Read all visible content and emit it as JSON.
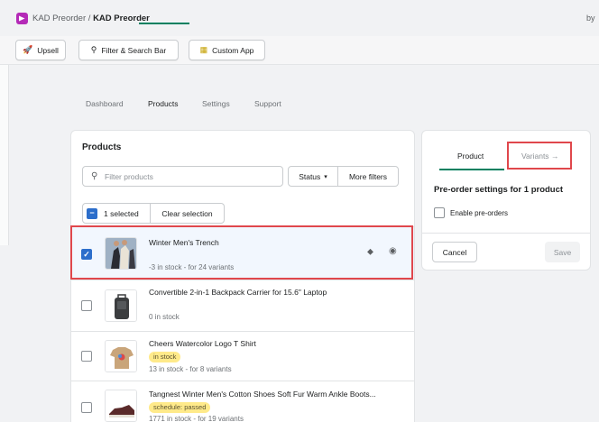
{
  "colors": {
    "accent_green": "#008060",
    "highlight_red": "#e0474c",
    "selected_blue": "#2c6ecb",
    "badge_yellow": "#ffea8a",
    "app_purple": "#b42ab7"
  },
  "header": {
    "breadcrumb_app": "KAD Preorder",
    "breadcrumb_sep": " / ",
    "breadcrumb_page": "KAD Preorder",
    "right_text": "by"
  },
  "toolbar": {
    "upsell": {
      "label": "Upsell",
      "icon": "rocket-icon"
    },
    "filter": {
      "label": "Filter & Search Bar",
      "icon": "search-icon"
    },
    "custom_app": {
      "label": "Custom App",
      "icon": "grid-icon"
    }
  },
  "tabs": [
    {
      "label": "Dashboard",
      "active": false
    },
    {
      "label": "Products",
      "active": true
    },
    {
      "label": "Settings",
      "active": false
    },
    {
      "label": "Support",
      "active": false
    }
  ],
  "products_card": {
    "title": "Products",
    "search_placeholder": "Filter products",
    "status_label": "Status",
    "more_filters_label": "More filters",
    "selected_label": "1 selected",
    "clear_label": "Clear selection"
  },
  "products": [
    {
      "name": "Winter Men's Trench",
      "stock": "-3 in stock - for 24 variants",
      "badge": "",
      "selected": true
    },
    {
      "name": "Convertible 2-in-1 Backpack Carrier for 15.6\" Laptop",
      "stock": "0 in stock",
      "badge": "",
      "selected": false
    },
    {
      "name": "Cheers Watercolor Logo T Shirt",
      "stock": "13 in stock - for 8 variants",
      "badge": "in stock",
      "selected": false
    },
    {
      "name": "Tangnest Winter Men's Cotton Shoes Soft Fur Warm Ankle Boots...",
      "stock": "1771 in stock - for 19 variants",
      "badge": "schedule: passed",
      "selected": false
    }
  ],
  "settings_card": {
    "tab_product": "Product",
    "tab_variants": "Variants",
    "tab_variants_arrow": "→",
    "title": "Pre-order settings for 1 product",
    "enable_label": "Enable pre-orders",
    "cancel_label": "Cancel",
    "save_label": "Save"
  }
}
